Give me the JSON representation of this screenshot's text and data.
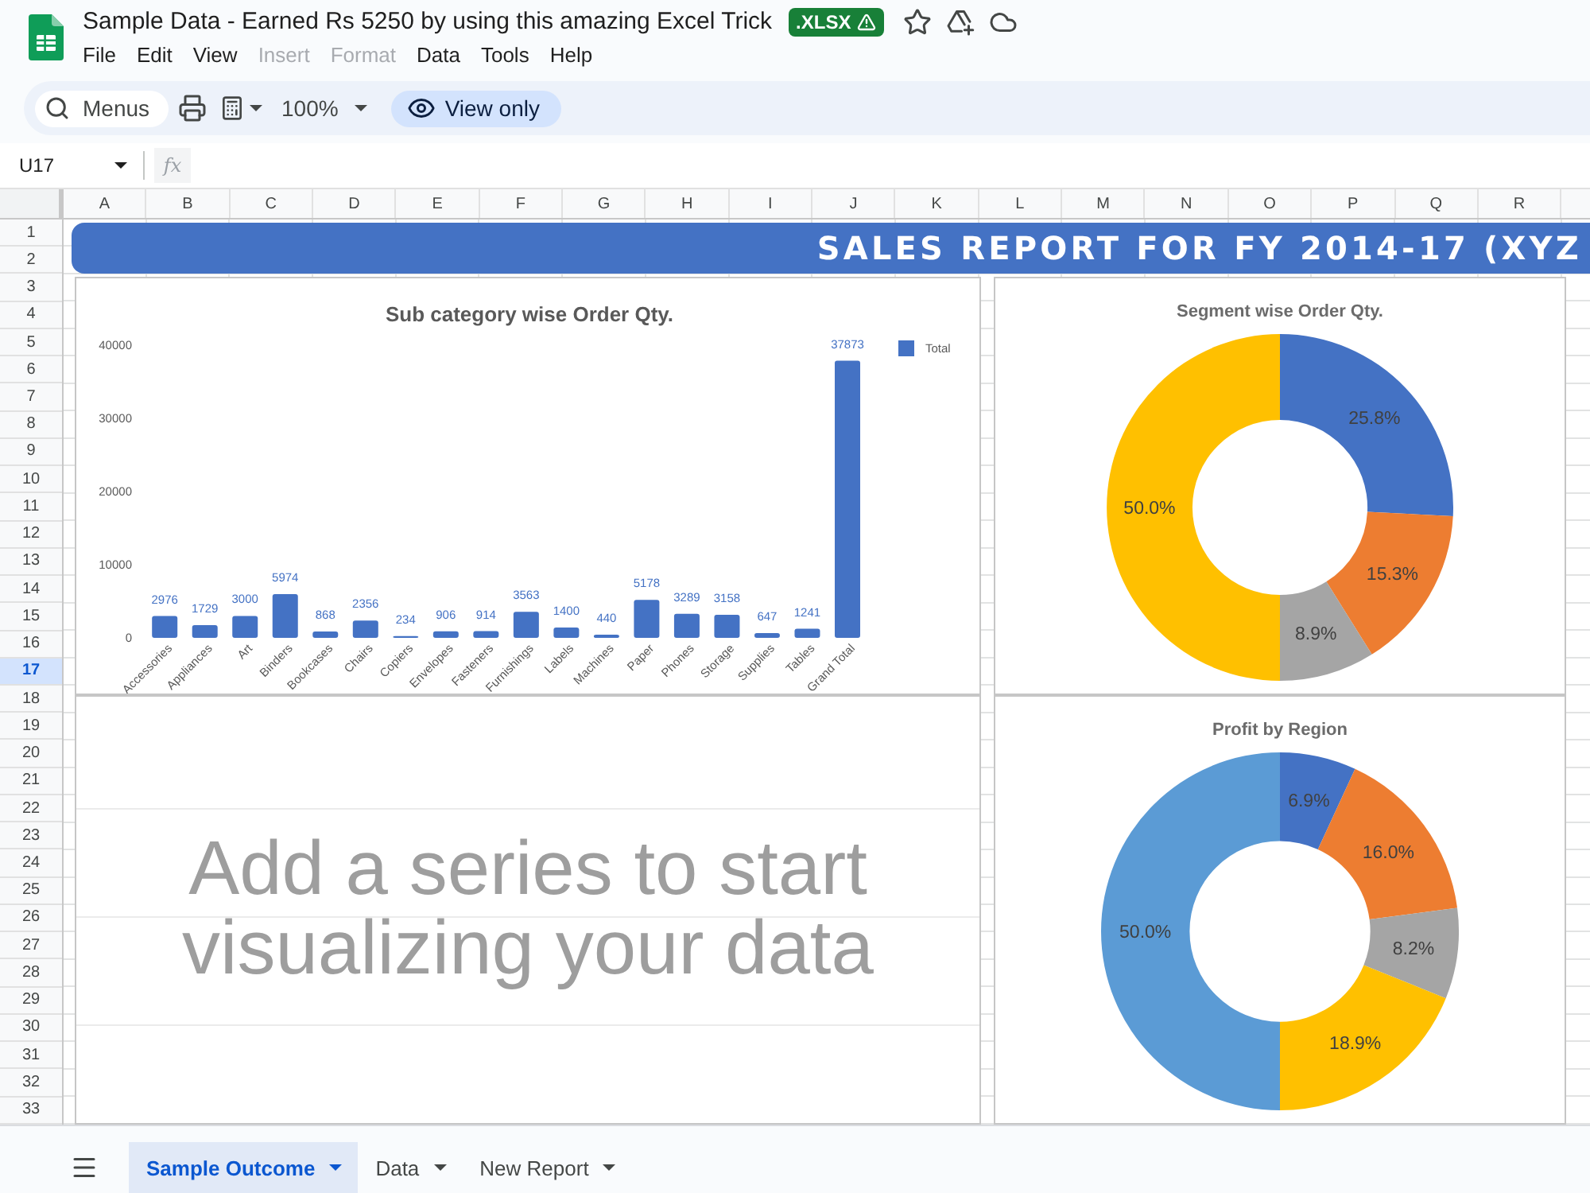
{
  "header": {
    "title": "Sample Data - Earned Rs 5250 by using this amazing Excel Trick",
    "badge": ".XLSX"
  },
  "menu_bar": [
    {
      "label": "File",
      "disabled": false
    },
    {
      "label": "Edit",
      "disabled": false
    },
    {
      "label": "View",
      "disabled": false
    },
    {
      "label": "Insert",
      "disabled": true
    },
    {
      "label": "Format",
      "disabled": true
    },
    {
      "label": "Data",
      "disabled": false
    },
    {
      "label": "Tools",
      "disabled": false
    },
    {
      "label": "Help",
      "disabled": false
    }
  ],
  "toolbar": {
    "search": {
      "placeholder": "Menus"
    },
    "zoom": "100%",
    "mode_button": "View only"
  },
  "formula_bar": {
    "cell_reference": "U17",
    "function_label": "fx"
  },
  "columns": [
    "A",
    "B",
    "C",
    "D",
    "E",
    "F",
    "G",
    "H",
    "I",
    "J",
    "K",
    "L",
    "M",
    "N",
    "O",
    "P",
    "Q",
    "R"
  ],
  "rows": [
    {
      "label": "1",
      "selected": false
    },
    {
      "label": "2",
      "selected": false
    },
    {
      "label": "3",
      "selected": false
    },
    {
      "label": "4",
      "selected": false
    },
    {
      "label": "5",
      "selected": false
    },
    {
      "label": "6",
      "selected": false
    },
    {
      "label": "7",
      "selected": false
    },
    {
      "label": "8",
      "selected": false
    },
    {
      "label": "9",
      "selected": false
    },
    {
      "label": "10",
      "selected": false
    },
    {
      "label": "11",
      "selected": false
    },
    {
      "label": "12",
      "selected": false
    },
    {
      "label": "13",
      "selected": false
    },
    {
      "label": "14",
      "selected": false
    },
    {
      "label": "15",
      "selected": false
    },
    {
      "label": "16",
      "selected": false
    },
    {
      "label": "17",
      "selected": true
    },
    {
      "label": "18",
      "selected": false
    },
    {
      "label": "19",
      "selected": false
    },
    {
      "label": "20",
      "selected": false
    },
    {
      "label": "21",
      "selected": false
    },
    {
      "label": "22",
      "selected": false
    },
    {
      "label": "23",
      "selected": false
    },
    {
      "label": "24",
      "selected": false
    },
    {
      "label": "25",
      "selected": false
    },
    {
      "label": "26",
      "selected": false
    },
    {
      "label": "27",
      "selected": false
    },
    {
      "label": "28",
      "selected": false
    },
    {
      "label": "29",
      "selected": false
    },
    {
      "label": "30",
      "selected": false
    },
    {
      "label": "31",
      "selected": false
    },
    {
      "label": "32",
      "selected": false
    },
    {
      "label": "33",
      "selected": false
    }
  ],
  "banner": {
    "title": "SALES REPORT FOR FY 2014-17 (XYZ"
  },
  "charts": [
    {
      "kind": "chart",
      "chart_data": {
        "type": "bar",
        "title": "Sub category wise Order Qty.",
        "categories": [
          "Accessories",
          "Appliances",
          "Art",
          "Binders",
          "Bookcases",
          "Chairs",
          "Copiers",
          "Envelopes",
          "Fasteners",
          "Furnishings",
          "Labels",
          "Machines",
          "Paper",
          "Phones",
          "Storage",
          "Supplies",
          "Tables",
          "Grand Total"
        ],
        "series": [
          {
            "name": "Total",
            "color": "#4472c4",
            "values": [
              2976,
              1729,
              3000,
              5974,
              868,
              2356,
              234,
              906,
              914,
              3563,
              1400,
              440,
              5178,
              3289,
              3158,
              647,
              1241,
              37873
            ]
          }
        ],
        "ylim": [
          0,
          40000
        ],
        "yticks": [
          0,
          10000,
          20000,
          30000,
          40000
        ],
        "data_labels": true
      }
    },
    {
      "kind": "chart",
      "chart_data": {
        "type": "donut",
        "title": "Segment wise Order Qty.",
        "values": [
          25.8,
          15.3,
          8.9,
          50.0
        ],
        "value_labels": [
          "25.8%",
          "15.3%",
          "8.9%",
          "50.0%"
        ],
        "colors": [
          "#4472c4",
          "#ed7d31",
          "#a5a5a5",
          "#ffc000"
        ]
      }
    },
    {
      "kind": "placeholder",
      "message": "Add a series to start visualizing your data"
    },
    {
      "kind": "chart",
      "chart_data": {
        "type": "donut",
        "title": "Profit by Region",
        "values": [
          6.9,
          16.0,
          8.2,
          18.9,
          50.0
        ],
        "value_labels": [
          "6.9%",
          "16.0%",
          "8.2%",
          "18.9%",
          "50.0%"
        ],
        "colors": [
          "#4472c4",
          "#ed7d31",
          "#a5a5a5",
          "#ffc000",
          "#5b9bd5"
        ]
      }
    }
  ],
  "sheet_tabs": [
    {
      "label": "Sample Outcome",
      "selected": true
    },
    {
      "label": "Data",
      "selected": false
    },
    {
      "label": "New Report",
      "selected": false
    }
  ]
}
